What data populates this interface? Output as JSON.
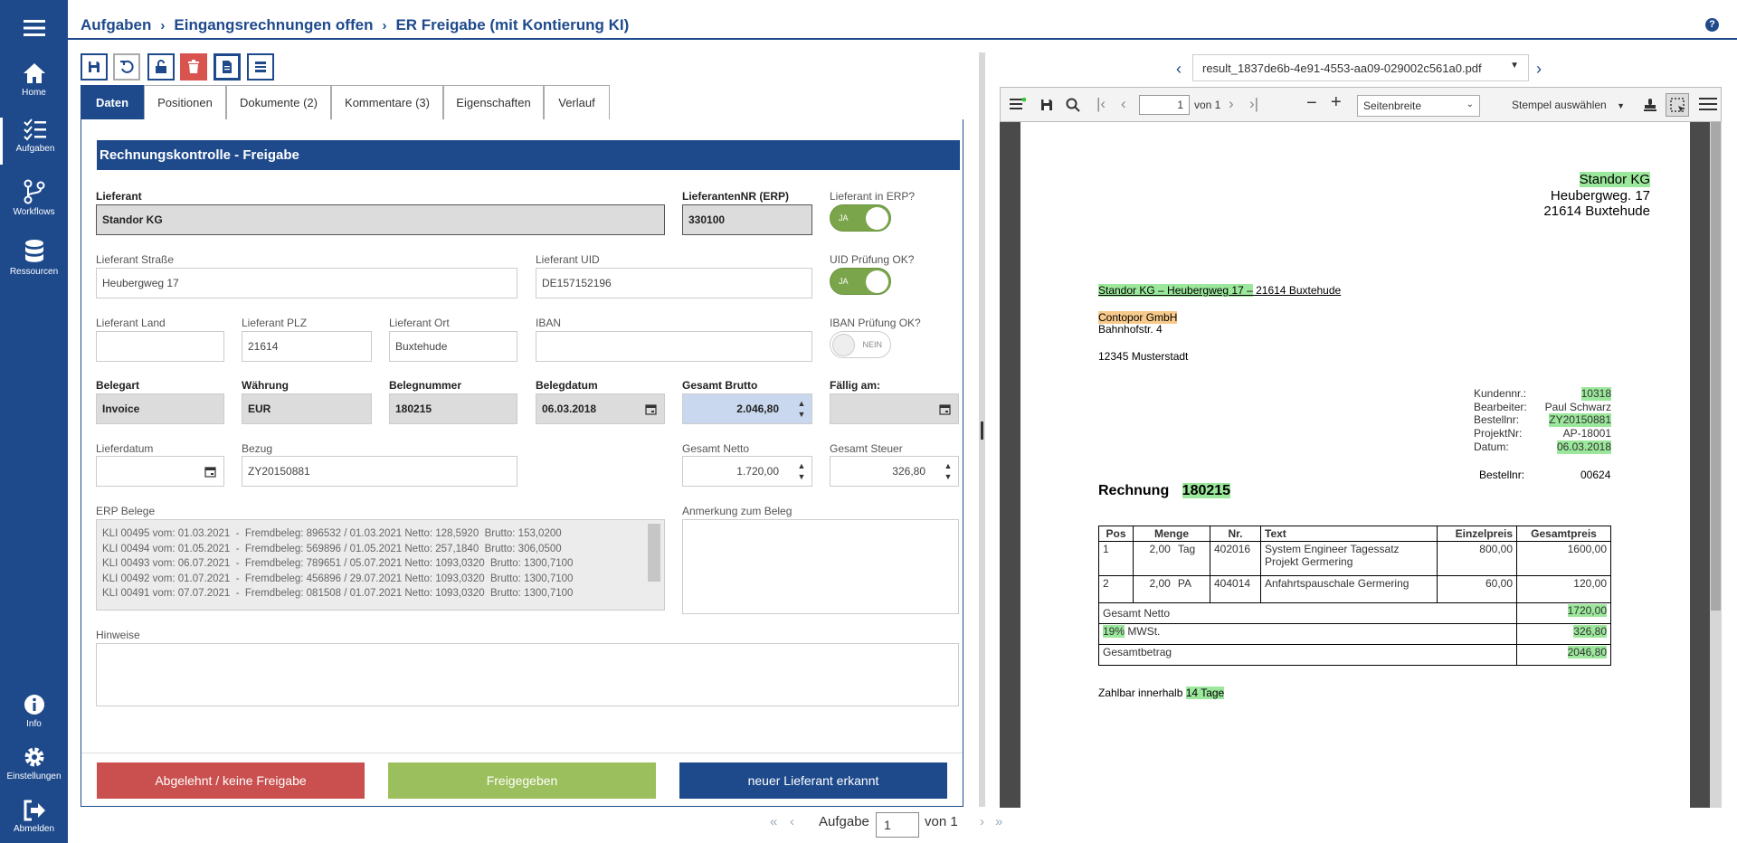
{
  "sidebar": {
    "items": [
      {
        "label": "",
        "icon": "menu-icon"
      },
      {
        "label": "Home",
        "icon": "home-icon"
      },
      {
        "label": "Aufgaben",
        "icon": "tasks-icon"
      },
      {
        "label": "Workflows",
        "icon": "workflow-icon"
      },
      {
        "label": "Ressourcen",
        "icon": "database-icon"
      },
      {
        "label": "Info",
        "icon": "info-icon"
      },
      {
        "label": "Einstellungen",
        "icon": "gear-icon"
      },
      {
        "label": "Abmelden",
        "icon": "logout-icon"
      }
    ]
  },
  "header": {
    "breadcrumb": [
      "Aufgaben",
      "Eingangsrechnungen offen",
      "ER Freigabe (mit Kontierung KI)"
    ],
    "help": "?"
  },
  "tabs": [
    {
      "label": "Daten",
      "active": true
    },
    {
      "label": "Positionen"
    },
    {
      "label": "Dokumente (2)"
    },
    {
      "label": "Kommentare (3)"
    },
    {
      "label": "Eigenschaften"
    },
    {
      "label": "Verlauf"
    }
  ],
  "form": {
    "title": "Rechnungskontrolle - Freigabe",
    "lieferant": {
      "label": "Lieferant",
      "value": "Standor KG"
    },
    "lieferantennr": {
      "label": "LieferantenNR (ERP)",
      "value": "330100"
    },
    "lieferant_erp": {
      "label": "Lieferant in ERP?",
      "toggle": "JA",
      "on": true
    },
    "strasse": {
      "label": "Lieferant Straße",
      "value": "Heubergweg 17"
    },
    "uid": {
      "label": "Lieferant UID",
      "value": "DE157152196"
    },
    "uid_ok": {
      "label": "UID Prüfung OK?",
      "toggle": "JA",
      "on": true
    },
    "land": {
      "label": "Lieferant Land",
      "value": ""
    },
    "plz": {
      "label": "Lieferant PLZ",
      "value": "21614"
    },
    "ort": {
      "label": "Lieferant Ort",
      "value": "Buxtehude"
    },
    "iban": {
      "label": "IBAN",
      "value": ""
    },
    "iban_ok": {
      "label": "IBAN Prüfung OK?",
      "toggle": "NEIN",
      "on": false
    },
    "belegart": {
      "label": "Belegart",
      "value": "Invoice"
    },
    "waehrung": {
      "label": "Währung",
      "value": "EUR"
    },
    "belegnummer": {
      "label": "Belegnummer",
      "value": "180215"
    },
    "belegdatum": {
      "label": "Belegdatum",
      "value": "06.03.2018"
    },
    "brutto": {
      "label": "Gesamt Brutto",
      "value": "2.046,80"
    },
    "faellig": {
      "label": "Fällig am:",
      "value": ""
    },
    "lieferdatum": {
      "label": "Lieferdatum",
      "value": ""
    },
    "bezug": {
      "label": "Bezug",
      "value": "ZY20150881"
    },
    "netto": {
      "label": "Gesamt Netto",
      "value": "1.720,00"
    },
    "steuer": {
      "label": "Gesamt Steuer",
      "value": "326,80"
    },
    "erp_belege": {
      "label": "ERP Belege",
      "lines": [
        "KLI 00495 vom: 01.03.2021  -  Fremdbeleg: 896532 / 01.03.2021 Netto: 128,5920  Brutto: 153,0200",
        "KLI 00494 vom: 01.05.2021  -  Fremdbeleg: 569896 / 01.05.2021 Netto: 257,1840  Brutto: 306,0500",
        "KLI 00493 vom: 06.07.2021  -  Fremdbeleg: 789651 / 05.07.2021 Netto: 1093,0320  Brutto: 1300,7100",
        "KLI 00492 vom: 01.07.2021  -  Fremdbeleg: 456896 / 29.07.2021 Netto: 1093,0320  Brutto: 1300,7100",
        "KLI 00491 vom: 07.07.2021  -  Fremdbeleg: 081508 / 01.07.2021 Netto: 1093,0320  Brutto: 1300,7100"
      ]
    },
    "anmerkung": {
      "label": "Anmerkung zum Beleg",
      "value": ""
    },
    "hinweise": {
      "label": "Hinweise",
      "value": ""
    }
  },
  "actions": {
    "reject": "Abgelehnt / keine Freigabe",
    "approve": "Freigegeben",
    "new_supplier": "neuer Lieferant erkannt"
  },
  "pager": {
    "label": "Aufgabe",
    "page": "1",
    "of": "von 1"
  },
  "pdf": {
    "filename": "result_1837de6b-4e91-4553-aa09-029002c561a0.pdf",
    "page": "1",
    "of": "von 1",
    "zoom": "Seitenbreite",
    "stamp": "Stempel auswählen",
    "doc": {
      "sender_name": "Standor KG",
      "sender_street": "Heubergweg. 17",
      "sender_city": "21614 Buxtehude",
      "return_addr_a": "Standor KG – Heubergweg 17 –",
      "return_addr_b": " 21614 Buxtehude",
      "recipient_name": "Contopor GmbH",
      "recipient_street": "Bahnhofstr. 4",
      "recipient_city": "12345 Musterstadt",
      "meta": [
        {
          "k": "Kundennr.:",
          "v": "10318",
          "hl": true
        },
        {
          "k": "Bearbeiter:",
          "v": "Paul Schwarz",
          "hl": false
        },
        {
          "k": "Bestellnr:",
          "v": "ZY20150881",
          "hl": true
        },
        {
          "k": "ProjektNr:",
          "v": "AP-18001",
          "hl": false
        },
        {
          "k": "Datum:",
          "v": "06.03.2018",
          "hl": true
        }
      ],
      "bestellnr_label": "Bestellnr:",
      "bestellnr_value": "00624",
      "rechnung_label": "Rechnung",
      "rechnung_nr": "180215",
      "table_headers": [
        "Pos",
        "Menge",
        "Nr.",
        "Text",
        "Einzelpreis",
        "Gesamtpreis"
      ],
      "rows": [
        {
          "pos": "1",
          "menge": "2,00",
          "einheit": "Tag",
          "nr": "402016",
          "text1": "System Engineer Tagessatz",
          "text2": "Projekt Germering",
          "einzel": "800,00",
          "gesamt": "1600,00"
        },
        {
          "pos": "2",
          "menge": "2,00",
          "einheit": "PA",
          "nr": "404014",
          "text1": "Anfahrtspauschale Germering",
          "text2": "",
          "einzel": "60,00",
          "gesamt": "120,00"
        }
      ],
      "netto_label": "Gesamt Netto",
      "netto_value": "1720,00",
      "mwst_pct": "19%",
      "mwst_label": " MWSt.",
      "mwst_value": "326,80",
      "total_label": "Gesamtbetrag",
      "total_value": "2046,80",
      "zahlbar_label": "Zahlbar innerhalb ",
      "zahlbar_value": "14 Tage"
    }
  }
}
